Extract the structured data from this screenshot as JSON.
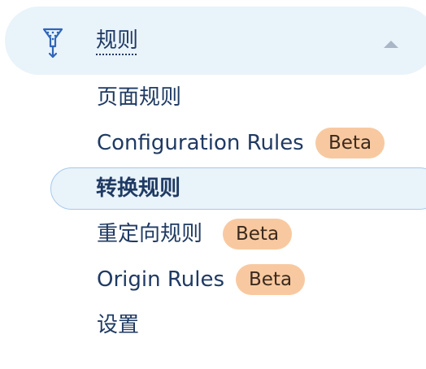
{
  "header": {
    "title": "规则",
    "icon": "filter-icon",
    "expand_icon": "chevron-up-icon"
  },
  "menu": {
    "items": [
      {
        "label": "页面规则",
        "badge": null,
        "active": false
      },
      {
        "label": "Configuration Rules",
        "badge": "Beta",
        "active": false
      },
      {
        "label": "转换规则",
        "badge": null,
        "active": true
      },
      {
        "label": "重定向规则",
        "badge": "Beta",
        "active": false
      },
      {
        "label": "Origin Rules",
        "badge": "Beta",
        "active": false
      },
      {
        "label": "设置",
        "badge": null,
        "active": false
      }
    ]
  },
  "colors": {
    "text": "#1f3a63",
    "header_bg": "#e9f3fa",
    "active_bg": "#e9f3fa",
    "active_border": "#a8c8ea",
    "badge_bg": "#f8c9a0",
    "chevron": "#a9b6c6"
  }
}
